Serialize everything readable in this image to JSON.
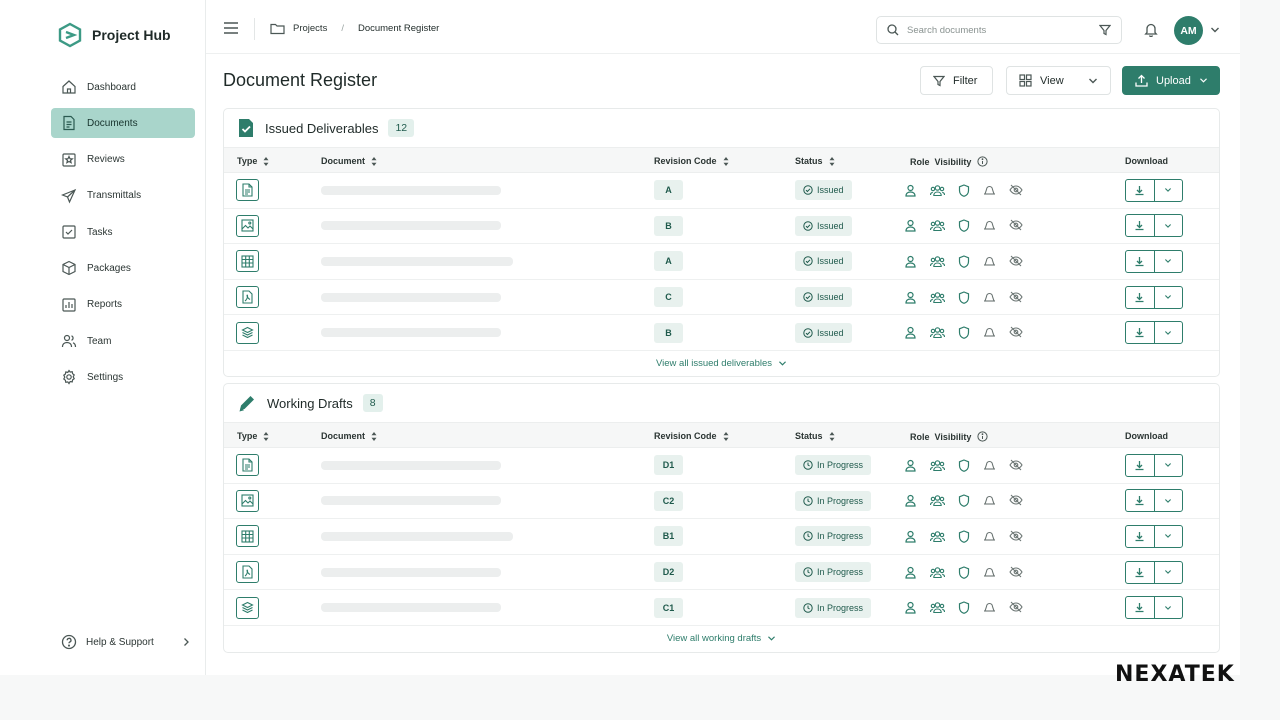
{
  "brand": {
    "name": "Project Hub"
  },
  "sidebar": {
    "items": [
      {
        "label": "Dashboard",
        "icon": "home-icon",
        "active": false
      },
      {
        "label": "Documents",
        "icon": "document-icon",
        "active": true
      },
      {
        "label": "Reviews",
        "icon": "review-icon",
        "active": false
      },
      {
        "label": "Transmittals",
        "icon": "send-icon",
        "active": false
      },
      {
        "label": "Tasks",
        "icon": "checkbox-icon",
        "active": false
      },
      {
        "label": "Packages",
        "icon": "package-icon",
        "active": false
      },
      {
        "label": "Reports",
        "icon": "chart-icon",
        "active": false
      },
      {
        "label": "Team",
        "icon": "team-icon",
        "active": false
      },
      {
        "label": "Settings",
        "icon": "gear-icon",
        "active": false
      }
    ],
    "help_label": "Help & Support"
  },
  "topbar": {
    "breadcrumb": [
      "Projects",
      "Document Register"
    ],
    "search_placeholder": "Search documents",
    "avatar_initials": "AM"
  },
  "page": {
    "title": "Document Register",
    "filter_label": "Filter",
    "view_label": "View",
    "upload_label": "Upload"
  },
  "columns": {
    "type": "Type",
    "document": "Document",
    "revision": "Revision Code",
    "status": "Status",
    "role_visibility": "Role  Visibility",
    "download": "Download"
  },
  "issued": {
    "title": "Issued Deliverables",
    "count": "12",
    "view_all": "View all issued deliverables",
    "rows": [
      {
        "type_icon": "document-file-icon",
        "revision": "A",
        "status": "Issued"
      },
      {
        "type_icon": "image-file-icon",
        "revision": "B",
        "status": "Issued"
      },
      {
        "type_icon": "spreadsheet-file-icon",
        "revision": "A",
        "status": "Issued"
      },
      {
        "type_icon": "pdf-file-icon",
        "revision": "C",
        "status": "Issued"
      },
      {
        "type_icon": "layers-file-icon",
        "revision": "B",
        "status": "Issued"
      }
    ]
  },
  "drafts": {
    "title": "Working Drafts",
    "count": "8",
    "view_all": "View all working drafts",
    "rows": [
      {
        "type_icon": "document-file-icon",
        "revision": "D1",
        "status": "In Progress"
      },
      {
        "type_icon": "image-file-icon",
        "revision": "C2",
        "status": "In Progress"
      },
      {
        "type_icon": "spreadsheet-file-icon",
        "revision": "B1",
        "status": "In Progress"
      },
      {
        "type_icon": "pdf-file-icon",
        "revision": "D2",
        "status": "In Progress"
      },
      {
        "type_icon": "layers-file-icon",
        "revision": "C1",
        "status": "In Progress"
      }
    ]
  },
  "watermark": "NEXATEK",
  "colors": {
    "accent": "#2e7d6b",
    "active_nav": "#a9d5cb",
    "badge_bg": "#e8f1ee"
  }
}
